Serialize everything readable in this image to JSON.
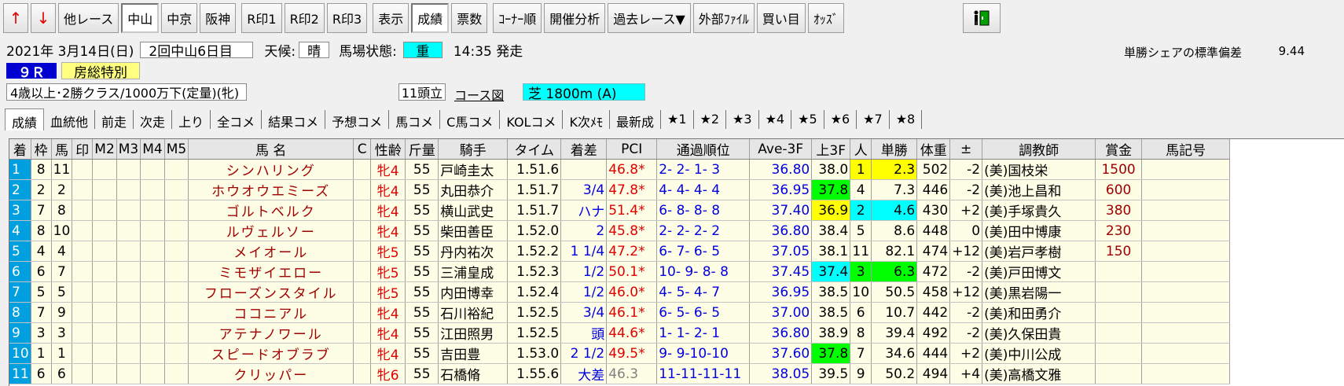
{
  "toolbar": {
    "up_arrow": "↑",
    "down_arrow": "↓",
    "buttons": [
      {
        "label": "他レース",
        "pressed": false
      },
      {
        "label": "中山",
        "pressed": true
      },
      {
        "label": "中京",
        "pressed": false
      },
      {
        "label": "阪神",
        "pressed": false
      },
      {
        "label": "R印1",
        "pressed": false
      },
      {
        "label": "R印2",
        "pressed": false
      },
      {
        "label": "R印3",
        "pressed": false
      },
      {
        "label": "表示",
        "pressed": false
      },
      {
        "label": "成績",
        "pressed": true
      },
      {
        "label": "票数",
        "pressed": false
      },
      {
        "label": "ｺｰﾅｰ順",
        "pressed": false
      },
      {
        "label": "開催分析",
        "pressed": false
      },
      {
        "label": "過去レース▼",
        "pressed": false
      },
      {
        "label": "外部ﾌｧｲﾙ",
        "pressed": false
      },
      {
        "label": "買い目",
        "pressed": false
      },
      {
        "label": "ｵｯｽﾞ",
        "pressed": false
      }
    ],
    "exit_icon": "exit-icon"
  },
  "race": {
    "date": "2021年 3月14日(日)",
    "meeting": "2回中山6日目",
    "weather_label": "天候:",
    "weather": "晴",
    "track_label": "馬場状態:",
    "track": "重",
    "post_time": "14:35 発走",
    "number": "９Ｒ",
    "name": "房総特別",
    "conditions": "4歳以上･2勝クラス/1000万下(定量)(牝)",
    "runners": "11頭立",
    "course_link": "コース図",
    "course": "芝 1800m (A)"
  },
  "win_share": {
    "label": "単勝シェアの標準偏差",
    "value": "9.44"
  },
  "tabs": [
    "成績",
    "血統他",
    "前走",
    "次走",
    "上り",
    "全コメ",
    "結果コメ",
    "予想コメ",
    "馬コメ",
    "C馬コメ",
    "KOLコメ",
    "K次ﾒﾓ",
    "最新成",
    "★1",
    "★2",
    "★3",
    "★4",
    "★5",
    "★6",
    "★7",
    "★8"
  ],
  "table": {
    "headers": [
      "着",
      "枠",
      "馬",
      "印",
      "M2",
      "M3",
      "M4",
      "M5",
      "馬 名",
      "C",
      "性齢",
      "斤量",
      "騎手",
      "タイム",
      "着差",
      "PCI",
      "通過順位",
      "Ave-3F",
      "上3F",
      "人",
      "単勝",
      "体重",
      "±",
      "調教師",
      "賞金",
      "馬記号"
    ],
    "rows": [
      {
        "rank": "1",
        "frame": "8",
        "horse": "11",
        "name": "シンハリング",
        "sex_age": "牝4",
        "weight": "55",
        "jockey": "戸崎圭太",
        "time": "1.51.6",
        "margin": "",
        "pci": "46.8*",
        "passing": "2- 2- 1- 3",
        "ave3f": "36.80",
        "last3f": "38.0",
        "pop": "1",
        "odds": "2.3",
        "body": "502",
        "diff": "-2",
        "trainer": "(美)国枝栄",
        "prize": "1500",
        "mark": ""
      },
      {
        "rank": "2",
        "frame": "2",
        "horse": "2",
        "name": "ホウオウエミーズ",
        "sex_age": "牝4",
        "weight": "55",
        "jockey": "丸田恭介",
        "time": "1.51.7",
        "margin": "3/4",
        "pci": "47.8*",
        "passing": "4- 4- 4- 4",
        "ave3f": "36.95",
        "last3f": "37.8",
        "pop": "4",
        "odds": "7.3",
        "body": "446",
        "diff": "-2",
        "trainer": "(美)池上昌和",
        "prize": "600",
        "mark": ""
      },
      {
        "rank": "3",
        "frame": "7",
        "horse": "8",
        "name": "ゴルトベルク",
        "sex_age": "牝4",
        "weight": "55",
        "jockey": "横山武史",
        "time": "1.51.7",
        "margin": "ハナ",
        "pci": "51.4*",
        "passing": "6- 8- 8- 8",
        "ave3f": "37.40",
        "last3f": "36.9",
        "pop": "2",
        "odds": "4.6",
        "body": "430",
        "diff": "+2",
        "trainer": "(美)手塚貴久",
        "prize": "380",
        "mark": ""
      },
      {
        "rank": "4",
        "frame": "8",
        "horse": "10",
        "name": "ルヴェルソー",
        "sex_age": "牝4",
        "weight": "55",
        "jockey": "柴田善臣",
        "time": "1.52.0",
        "margin": "2",
        "pci": "45.8*",
        "passing": "2- 2- 2- 2",
        "ave3f": "36.80",
        "last3f": "38.4",
        "pop": "5",
        "odds": "8.6",
        "body": "448",
        "diff": "0",
        "trainer": "(美)田中博康",
        "prize": "230",
        "mark": ""
      },
      {
        "rank": "5",
        "frame": "4",
        "horse": "4",
        "name": "メイオール",
        "sex_age": "牝5",
        "weight": "55",
        "jockey": "丹内祐次",
        "time": "1.52.2",
        "margin": "1 1/4",
        "pci": "47.2*",
        "passing": "6- 7- 6- 5",
        "ave3f": "37.05",
        "last3f": "38.1",
        "pop": "11",
        "odds": "82.1",
        "body": "474",
        "diff": "+12",
        "trainer": "(美)岩戸孝樹",
        "prize": "150",
        "mark": ""
      },
      {
        "rank": "6",
        "frame": "6",
        "horse": "7",
        "name": "ミモザイエロー",
        "sex_age": "牝5",
        "weight": "55",
        "jockey": "三浦皇成",
        "time": "1.52.3",
        "margin": "1/2",
        "pci": "50.1*",
        "passing": "10- 9- 8- 8",
        "ave3f": "37.45",
        "last3f": "37.4",
        "pop": "3",
        "odds": "6.3",
        "body": "472",
        "diff": "-2",
        "trainer": "(美)戸田博文",
        "prize": "",
        "mark": ""
      },
      {
        "rank": "7",
        "frame": "5",
        "horse": "5",
        "name": "フローズンスタイル",
        "sex_age": "牝5",
        "weight": "55",
        "jockey": "内田博幸",
        "time": "1.52.4",
        "margin": "1/2",
        "pci": "46.0*",
        "passing": "4- 5- 4- 7",
        "ave3f": "36.95",
        "last3f": "38.5",
        "pop": "10",
        "odds": "50.5",
        "body": "458",
        "diff": "+12",
        "trainer": "(美)黒岩陽一",
        "prize": "",
        "mark": ""
      },
      {
        "rank": "8",
        "frame": "7",
        "horse": "9",
        "name": "ココニアル",
        "sex_age": "牝4",
        "weight": "55",
        "jockey": "石川裕紀",
        "time": "1.52.5",
        "margin": "3/4",
        "pci": "46.1*",
        "passing": "6- 5- 6- 5",
        "ave3f": "37.00",
        "last3f": "38.5",
        "pop": "6",
        "odds": "10.7",
        "body": "442",
        "diff": "-2",
        "trainer": "(美)和田勇介",
        "prize": "",
        "mark": ""
      },
      {
        "rank": "9",
        "frame": "3",
        "horse": "3",
        "name": "アテナノワール",
        "sex_age": "牝4",
        "weight": "55",
        "jockey": "江田照男",
        "time": "1.52.5",
        "margin": "頭",
        "pci": "44.6*",
        "passing": "1- 1- 2- 1",
        "ave3f": "36.80",
        "last3f": "38.9",
        "pop": "8",
        "odds": "39.4",
        "body": "492",
        "diff": "-2",
        "trainer": "(美)久保田貴",
        "prize": "",
        "mark": ""
      },
      {
        "rank": "10",
        "frame": "1",
        "horse": "1",
        "name": "スピードオブラブ",
        "sex_age": "牝4",
        "weight": "55",
        "jockey": "吉田豊",
        "time": "1.53.0",
        "margin": "2 1/2",
        "pci": "49.5*",
        "passing": "9- 9-10-10",
        "ave3f": "37.60",
        "last3f": "37.8",
        "pop": "7",
        "odds": "34.6",
        "body": "444",
        "diff": "+2",
        "trainer": "(美)中川公成",
        "prize": "",
        "mark": ""
      },
      {
        "rank": "11",
        "frame": "6",
        "horse": "6",
        "name": "クリッパー",
        "sex_age": "牝6",
        "weight": "55",
        "jockey": "石橋脩",
        "time": "1.55.6",
        "margin": "大差",
        "pci": "46.3",
        "passing": "11-11-11-11",
        "ave3f": "38.05",
        "last3f": "39.5",
        "pop": "9",
        "odds": "50.2",
        "body": "494",
        "diff": "+4",
        "trainer": "(美)高橋文雅",
        "prize": "",
        "mark": ""
      }
    ]
  },
  "highlight_colors": {
    "yellow": "#ffff00",
    "cyan": "#00ffff",
    "green": "#00ff00",
    "rank_bg": "#00a0e0",
    "row_bg": "#fefee6"
  }
}
